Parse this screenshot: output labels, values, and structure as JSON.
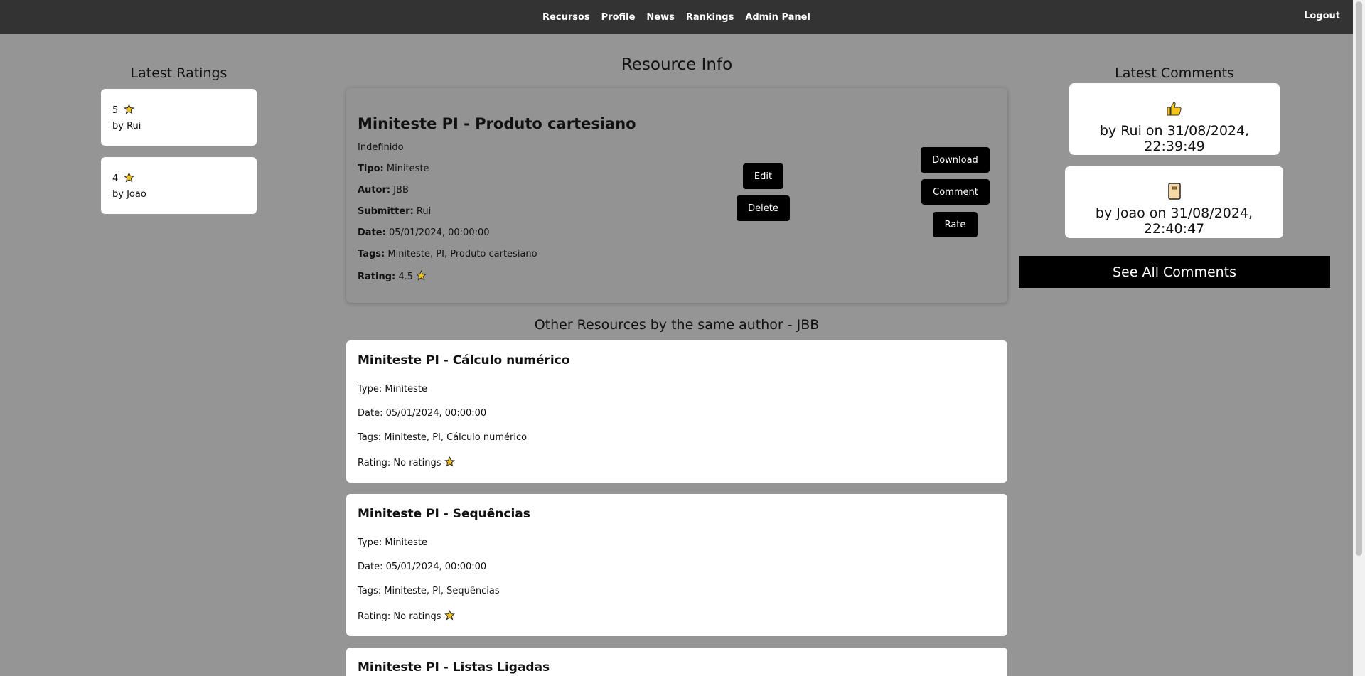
{
  "nav": {
    "links": [
      "Recursos",
      "Profile",
      "News",
      "Rankings",
      "Admin Panel"
    ],
    "logout": "Logout"
  },
  "latest_ratings": {
    "heading": "Latest Ratings",
    "items": [
      {
        "value": "5",
        "by": "by Rui"
      },
      {
        "value": "4",
        "by": "by Joao"
      }
    ]
  },
  "resource": {
    "heading": "Resource Info",
    "title": "Miniteste PI - Produto cartesiano",
    "description": "Indefinido",
    "tipo_label": "Tipo:",
    "tipo": "Miniteste",
    "autor_label": "Autor:",
    "autor": "JBB",
    "submitter_label": "Submitter:",
    "submitter": "Rui",
    "date_label": "Date:",
    "date": "05/01/2024, 00:00:00",
    "tags_label": "Tags:",
    "tags": "Miniteste, PI, Produto cartesiano",
    "rating_label": "Rating:",
    "rating": "4.5",
    "buttons": {
      "edit": "Edit",
      "delete": "Delete",
      "download": "Download",
      "comment": "Comment",
      "rate": "Rate"
    }
  },
  "latest_comments": {
    "heading": "Latest Comments",
    "items": [
      {
        "icon": "thumbs-up-icon",
        "text": "by Rui on 31/08/2024, 22:39:49"
      },
      {
        "icon": "notebook-icon",
        "text": "by Joao on 31/08/2024, 22:40:47"
      }
    ],
    "see_all": "See All Comments"
  },
  "other_resources": {
    "heading": "Other Resources by the same author - JBB",
    "items": [
      {
        "title": "Miniteste PI - Cálculo numérico",
        "type": "Type: Miniteste",
        "date": "Date: 05/01/2024, 00:00:00",
        "tags": "Tags: Miniteste, PI, Cálculo numérico",
        "rating": "Rating: No ratings"
      },
      {
        "title": "Miniteste PI - Sequências",
        "type": "Type: Miniteste",
        "date": "Date: 05/01/2024, 00:00:00",
        "tags": "Tags: Miniteste, PI, Sequências",
        "rating": "Rating: No ratings"
      },
      {
        "title": "Miniteste PI - Listas Ligadas"
      }
    ]
  }
}
